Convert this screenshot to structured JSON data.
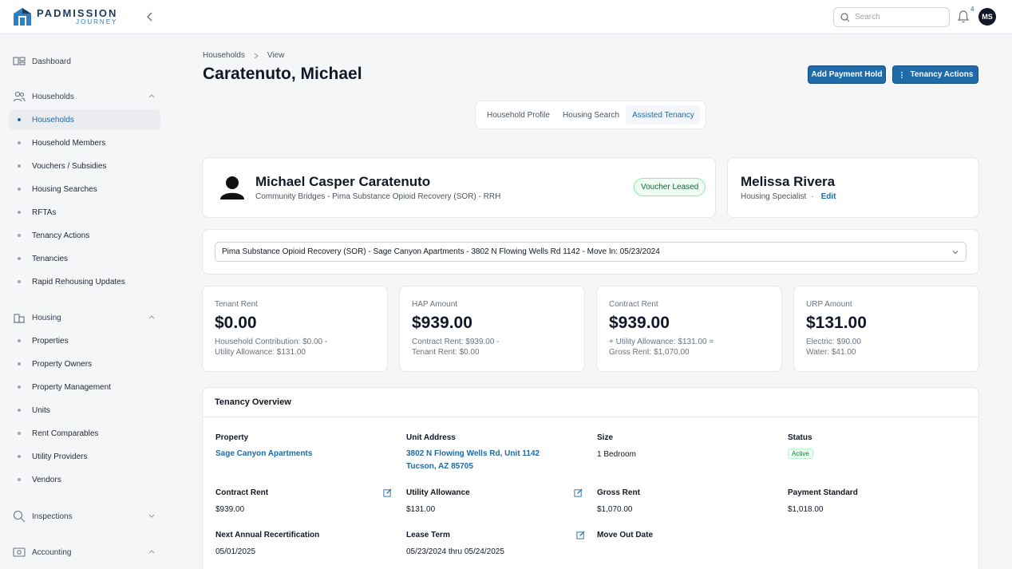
{
  "app": {
    "logo_line1": "PADMISSION",
    "logo_line2": "JOURNEY",
    "search_placeholder": "Search",
    "notification_count": "4",
    "user_initials": "MS",
    "accent": "#1f6aa8"
  },
  "sidebar": {
    "dashboard": "Dashboard",
    "households_section": "Households",
    "households_items": [
      "Households",
      "Household Members",
      "Vouchers / Subsidies",
      "Housing Searches",
      "RFTAs",
      "Tenancy Actions",
      "Tenancies",
      "Rapid Rehousing Updates"
    ],
    "housing_section": "Housing",
    "housing_items": [
      "Properties",
      "Property Owners",
      "Property Management",
      "Units",
      "Rent Comparables",
      "Utility Providers",
      "Vendors"
    ],
    "inspections_section": "Inspections",
    "accounting_section": "Accounting"
  },
  "breadcrumb": {
    "parent": "Households",
    "current": "View"
  },
  "page_title": "Caratenuto, Michael",
  "actions": {
    "payment_hold": "Add Payment Hold",
    "tenancy_actions": "Tenancy Actions"
  },
  "tabs": [
    "Household Profile",
    "Housing Search",
    "Assisted Tenancy"
  ],
  "household": {
    "name": "Michael Casper Caratenuto",
    "program": "Community Bridges - Pima Substance Opioid Recovery (SOR) - RRH",
    "status_badge": "Voucher Leased"
  },
  "specialist": {
    "name": "Melissa Rivera",
    "role": "Housing Specialist",
    "separator": "·",
    "edit": "Edit"
  },
  "tenancy_select": "Pima Substance Opioid Recovery (SOR) - Sage Canyon Apartments - 3802 N Flowing Wells Rd 1142 - Move In: 05/23/2024",
  "stats": [
    {
      "label": "Tenant Rent",
      "value": "$0.00",
      "line1": "Household Contribution: $0.00 -",
      "line2": "Utility Allowance: $131.00"
    },
    {
      "label": "HAP Amount",
      "value": "$939.00",
      "line1": "Contract Rent: $939.00 -",
      "line2": "Tenant Rent: $0.00"
    },
    {
      "label": "Contract Rent",
      "value": "$939.00",
      "line1": "+ Utility Allowance: $131.00 =",
      "line2": "Gross Rent: $1,070.00"
    },
    {
      "label": "URP Amount",
      "value": "$131.00",
      "line1": "Electric: $90.00",
      "line2": "Water: $41.00"
    }
  ],
  "overview": {
    "title": "Tenancy Overview",
    "property_label": "Property",
    "property_value": "Sage Canyon Apartments",
    "unit_address_label": "Unit Address",
    "unit_address_line1": "3802 N Flowing Wells Rd, Unit 1142",
    "unit_address_line2": "Tucson, AZ 85705",
    "size_label": "Size",
    "size_value": "1 Bedroom",
    "status_label": "Status",
    "status_value": "Active",
    "contract_rent_label": "Contract Rent",
    "contract_rent_value": "$939.00",
    "utility_allowance_label": "Utility Allowance",
    "utility_allowance_value": "$131.00",
    "gross_rent_label": "Gross Rent",
    "gross_rent_value": "$1,070.00",
    "payment_standard_label": "Payment Standard",
    "payment_standard_value": "$1,018.00",
    "recert_label": "Next Annual Recertification",
    "recert_value": "05/01/2025",
    "lease_term_label": "Lease Term",
    "lease_term_value": "05/23/2024 thru 05/24/2025",
    "move_out_label": "Move Out Date"
  }
}
